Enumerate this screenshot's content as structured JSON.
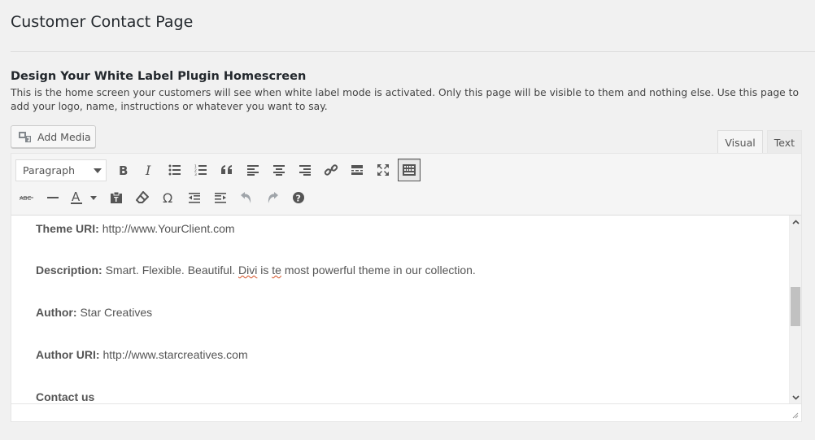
{
  "page": {
    "title": "Customer Contact Page"
  },
  "section": {
    "title": "Design Your White Label Plugin Homescreen",
    "description": "This is the home screen your customers will see when white label mode is activated. Only this page will be visible to them and nothing else. Use this page to add your logo, name, instructions or whatever you want to say."
  },
  "editor": {
    "add_media_label": "Add Media",
    "tabs": [
      {
        "label": "Visual",
        "active": true
      },
      {
        "label": "Text",
        "active": false
      }
    ],
    "format_select_value": "Paragraph",
    "content": {
      "theme_uri_label": "Theme URI:",
      "theme_uri_value": "http://www.YourClient.com",
      "description_label": "Description:",
      "description_pre": "Smart. Flexible. Beautiful.",
      "description_word1": "Divi",
      "description_mid": "is",
      "description_word2": "te",
      "description_post": "most powerful theme in our collection.",
      "author_label": "Author:",
      "author_value": "Star Creatives",
      "author_uri_label": "Author URI:",
      "author_uri_value": "http://www.starcreatives.com",
      "contact_label": "Contact us"
    },
    "toolbar_icons_row1": [
      "bold-icon",
      "italic-icon",
      "bullet-list-icon",
      "numbered-list-icon",
      "blockquote-icon",
      "align-left-icon",
      "align-center-icon",
      "align-right-icon",
      "link-icon",
      "read-more-icon",
      "fullscreen-icon",
      "toolbar-toggle-icon"
    ],
    "toolbar_icons_row2": [
      "strikethrough-icon",
      "horizontal-line-icon",
      "text-color-icon",
      "paste-as-text-icon",
      "clear-formatting-icon",
      "special-character-icon",
      "outdent-icon",
      "indent-icon",
      "undo-icon",
      "redo-icon",
      "help-icon"
    ]
  }
}
